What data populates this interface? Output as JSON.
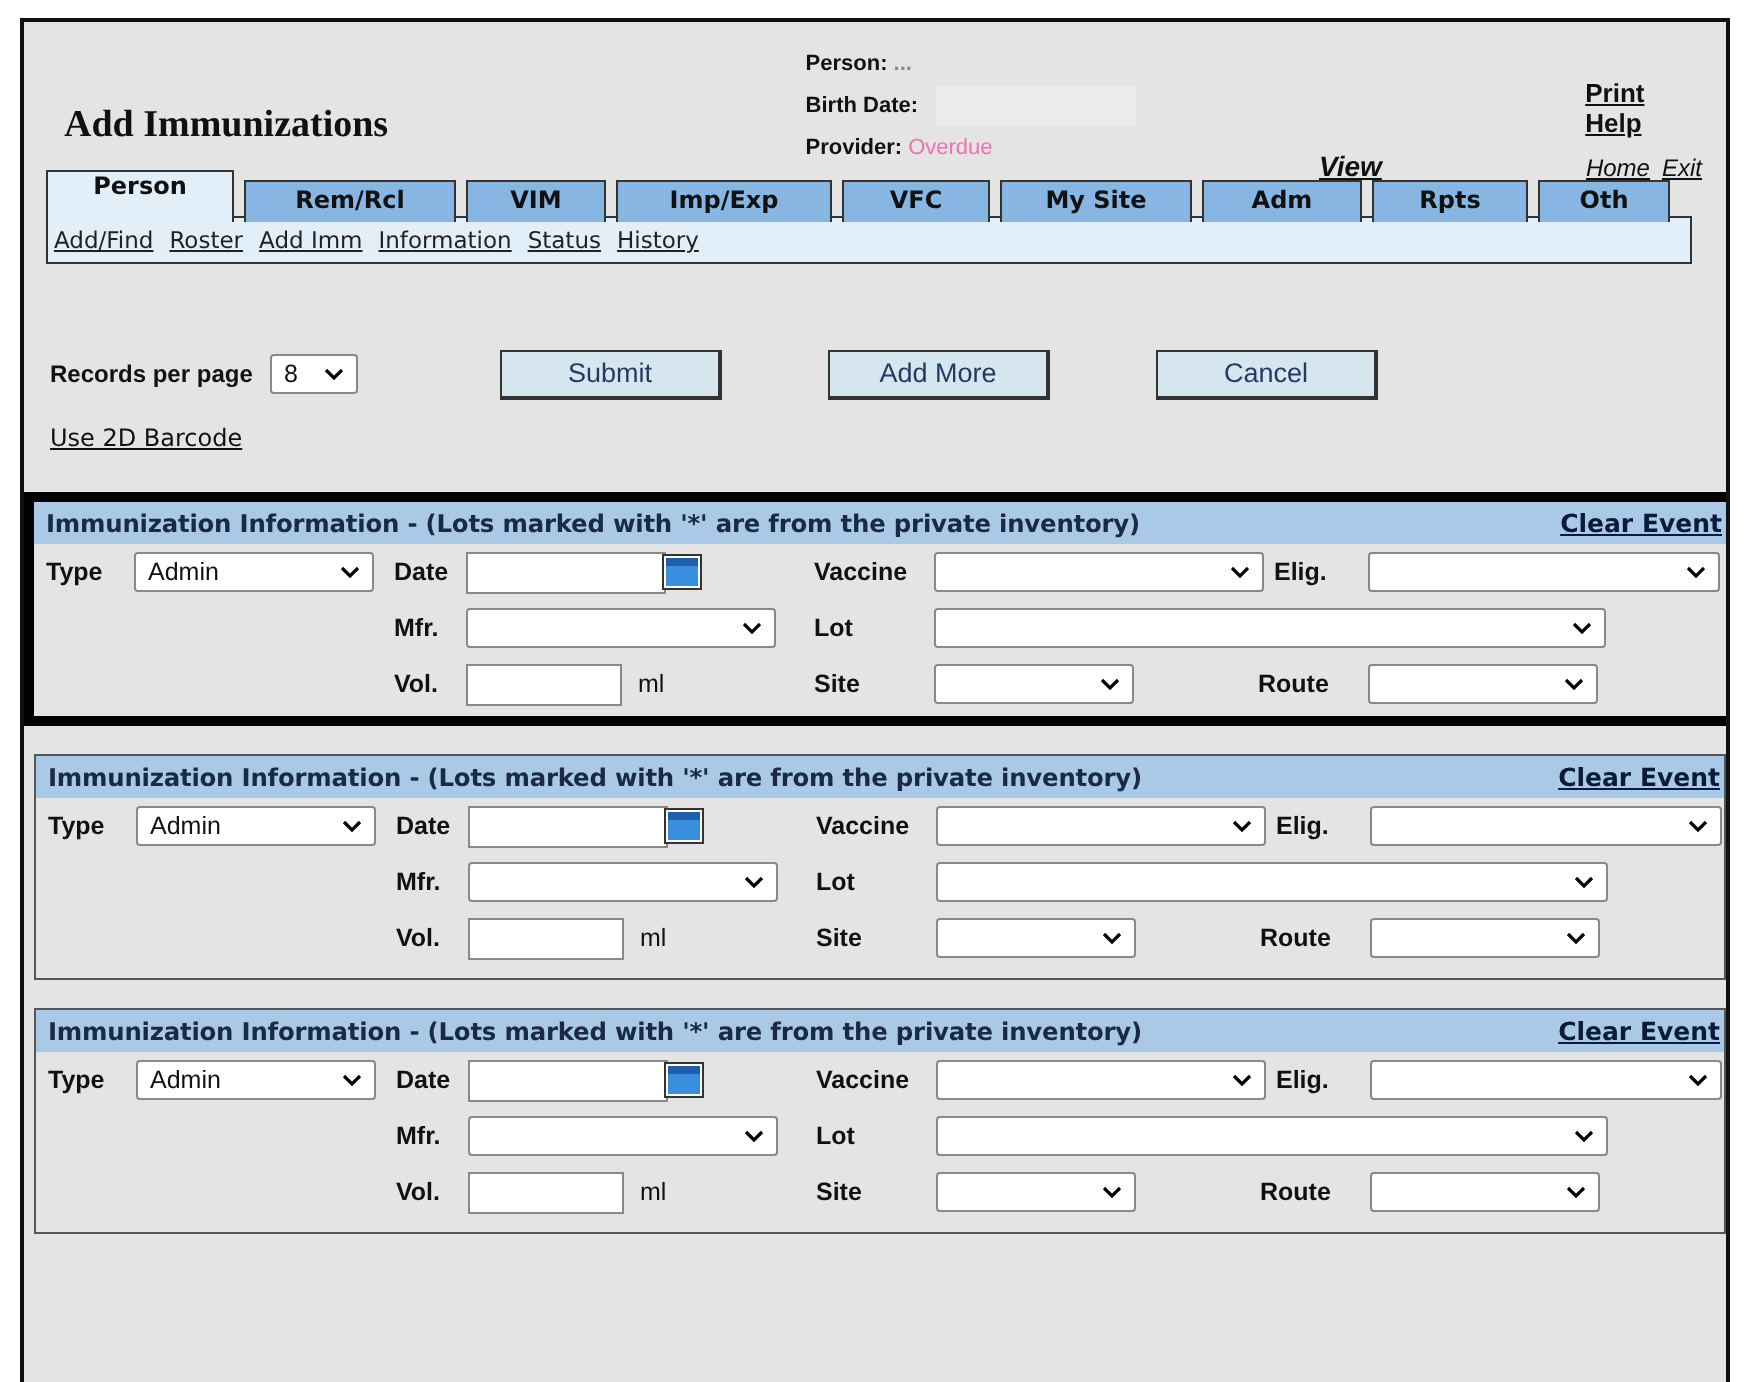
{
  "header": {
    "title": "Add Immunizations",
    "person_label": "Person:",
    "person_value": "...",
    "birth_date_label": "Birth Date:",
    "provider_label": "Provider:",
    "provider_value": "Overdue",
    "view_link": "View",
    "print_help_link": "Print Help",
    "home_link": "Home",
    "exit_link": "Exit"
  },
  "tabs": [
    {
      "label": "Person",
      "selected": true
    },
    {
      "label": "Rem/Rcl",
      "selected": false
    },
    {
      "label": "VIM",
      "selected": false
    },
    {
      "label": "Imp/Exp",
      "selected": false
    },
    {
      "label": "VFC",
      "selected": false
    },
    {
      "label": "My Site",
      "selected": false
    },
    {
      "label": "Adm",
      "selected": false
    },
    {
      "label": "Rpts",
      "selected": false
    },
    {
      "label": "Oth",
      "selected": false
    }
  ],
  "subnav": [
    "Add/Find",
    "Roster",
    "Add Imm",
    "Information",
    "Status",
    "History"
  ],
  "records": {
    "label": "Records per page",
    "value": "8"
  },
  "buttons": [
    "Submit",
    "Add More",
    "Cancel"
  ],
  "barcode_link": "Use 2D Barcode",
  "sections": [
    {
      "title": "Immunization Information - (Lots marked with '*' are from the private inventory)",
      "clear_link": "Clear Event",
      "highlighted": true,
      "type_label": "Type",
      "type_value": "Admin",
      "date_label": "Date",
      "vaccine_label": "Vaccine",
      "elig_label": "Elig.",
      "mfr_label": "Mfr.",
      "lot_label": "Lot",
      "vol_label": "Vol.",
      "unit": "ml",
      "site_label": "Site",
      "route_label": "Route"
    },
    {
      "title": "Immunization Information - (Lots marked with '*' are from the private inventory)",
      "clear_link": "Clear Event",
      "highlighted": false,
      "type_label": "Type",
      "type_value": "Admin",
      "date_label": "Date",
      "vaccine_label": "Vaccine",
      "elig_label": "Elig.",
      "mfr_label": "Mfr.",
      "lot_label": "Lot",
      "vol_label": "Vol.",
      "unit": "ml",
      "site_label": "Site",
      "route_label": "Route"
    },
    {
      "title": "Immunization Information - (Lots marked with '*' are from the private inventory)",
      "clear_link": "Clear Event",
      "highlighted": false,
      "type_label": "Type",
      "type_value": "Admin",
      "date_label": "Date",
      "vaccine_label": "Vaccine",
      "elig_label": "Elig.",
      "mfr_label": "Mfr.",
      "lot_label": "Lot",
      "vol_label": "Vol.",
      "unit": "ml",
      "site_label": "Site",
      "route_label": "Route"
    }
  ]
}
